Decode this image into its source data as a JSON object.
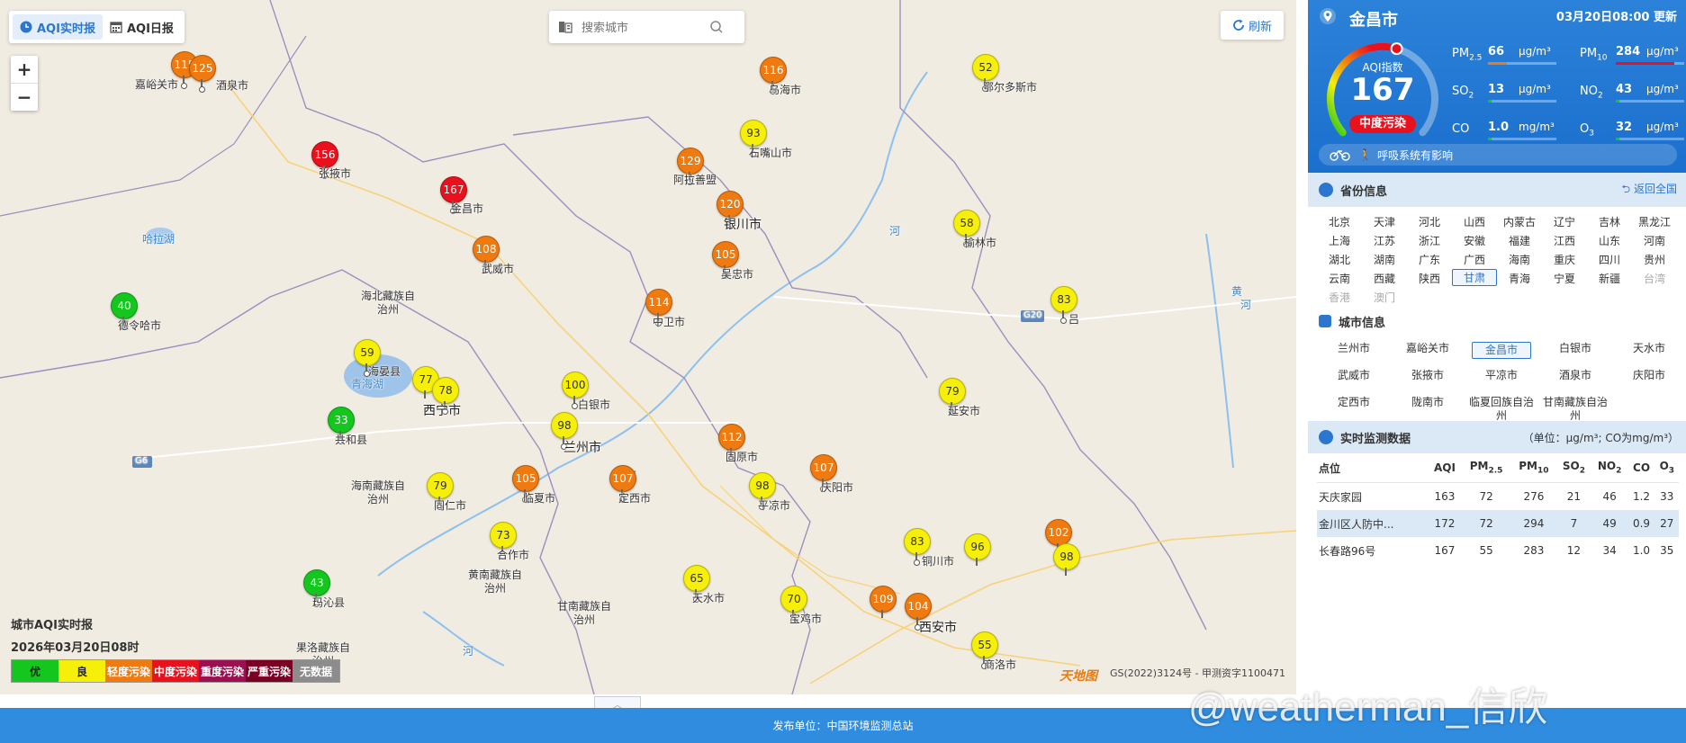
{
  "toolbar": {
    "tab_realtime": "AQI实时报",
    "tab_daily": "AQI日报",
    "search_placeholder": "搜索城市",
    "refresh_label": "刷新",
    "zoom_in": "+",
    "zoom_out": "−"
  },
  "map": {
    "legend_title": "城市AQI实时报",
    "legend_time": "2026年03月20日08时",
    "legend_items": [
      {
        "label": "优",
        "color": "#14c61e",
        "text_color": "#222222"
      },
      {
        "label": "良",
        "color": "#f5ef0a",
        "text_color": "#222222"
      },
      {
        "label": "轻度污染",
        "color": "#ef7a10",
        "text_color": "#ffffff"
      },
      {
        "label": "中度污染",
        "color": "#e8111d",
        "text_color": "#ffffff"
      },
      {
        "label": "重度污染",
        "color": "#9b1050",
        "text_color": "#ffffff"
      },
      {
        "label": "严重污染",
        "color": "#7a0024",
        "text_color": "#ffffff"
      },
      {
        "label": "无数据",
        "color": "#8c8c8c",
        "text_color": "#ffffff"
      }
    ],
    "copyright": "GS(2022)3124号 - 甲测资字1100471",
    "provider": "天地图",
    "regions": [
      "海北藏族自治州",
      "海南藏族自治州",
      "黄南藏族自治州",
      "甘南藏族自治州",
      "果洛藏族自治州"
    ],
    "water_labels": [
      "哈拉湖",
      "青海湖",
      "河",
      "河",
      "河",
      "黄",
      "河"
    ],
    "road_labels": [
      "G20",
      "G6"
    ],
    "markers": [
      {
        "value": "115",
        "level": "orange",
        "city": "嘉峪关市"
      },
      {
        "value": "125",
        "level": "orange",
        "city": "酒泉市"
      },
      {
        "value": "156",
        "level": "red",
        "city": "张掖市"
      },
      {
        "value": "167",
        "level": "red",
        "city": "金昌市"
      },
      {
        "value": "108",
        "level": "orange",
        "city": "武威市"
      },
      {
        "value": "40",
        "level": "green",
        "city": "德令哈市"
      },
      {
        "value": "59",
        "level": "yellow",
        "city": "海晏县"
      },
      {
        "value": "77",
        "level": "yellow",
        "city": ""
      },
      {
        "value": "78",
        "level": "yellow",
        "city": "西宁市"
      },
      {
        "value": "33",
        "level": "green",
        "city": "共和县"
      },
      {
        "value": "100",
        "level": "yellow",
        "city": "白银市"
      },
      {
        "value": "98",
        "level": "yellow",
        "city": "兰州市"
      },
      {
        "value": "105",
        "level": "orange",
        "city": "临夏市"
      },
      {
        "value": "107",
        "level": "orange",
        "city": "定西市"
      },
      {
        "value": "79",
        "level": "yellow",
        "city": "同仁市"
      },
      {
        "value": "73",
        "level": "yellow",
        "city": "合作市"
      },
      {
        "value": "43",
        "level": "green",
        "city": "玛沁县"
      },
      {
        "value": "65",
        "level": "yellow",
        "city": "天水市"
      },
      {
        "value": "70",
        "level": "yellow",
        "city": "宝鸡市"
      },
      {
        "value": "112",
        "level": "orange",
        "city": "固原市"
      },
      {
        "value": "98",
        "level": "yellow",
        "city": "平凉市"
      },
      {
        "value": "107",
        "level": "orange",
        "city": "庆阳市"
      },
      {
        "value": "114",
        "level": "orange",
        "city": "中卫市"
      },
      {
        "value": "105",
        "level": "orange",
        "city": "吴忠市"
      },
      {
        "value": "120",
        "level": "orange",
        "city": "银川市"
      },
      {
        "value": "129",
        "level": "orange",
        "city": "阿拉善盟"
      },
      {
        "value": "93",
        "level": "yellow",
        "city": "石嘴山市"
      },
      {
        "value": "116",
        "level": "orange",
        "city": "乌海市"
      },
      {
        "value": "52",
        "level": "yellow",
        "city": "鄂尔多斯市"
      },
      {
        "value": "58",
        "level": "yellow",
        "city": "榆林市"
      },
      {
        "value": "83",
        "level": "yellow",
        "city": "吕"
      },
      {
        "value": "79",
        "level": "yellow",
        "city": "延安市"
      },
      {
        "value": "83",
        "level": "yellow",
        "city": "铜川市"
      },
      {
        "value": "96",
        "level": "yellow",
        "city": ""
      },
      {
        "value": "102",
        "level": "orange",
        "city": ""
      },
      {
        "value": "98",
        "level": "yellow",
        "city": ""
      },
      {
        "value": "109",
        "level": "orange",
        "city": ""
      },
      {
        "value": "104",
        "level": "orange",
        "city": "西安市"
      },
      {
        "value": "55",
        "level": "yellow",
        "city": "商洛市"
      }
    ]
  },
  "panel": {
    "city": "金昌市",
    "update_time": "03月20日08:00 更新",
    "aqi_title": "AQI指数",
    "aqi_value": "167",
    "aqi_level": "中度污染",
    "aqi_fraction": 0.56,
    "pollutants": [
      {
        "name": "PM",
        "sub": "2.5",
        "value": "66",
        "unit": "μg/m³",
        "fill_fraction": 0.27,
        "color": "#ef7a10"
      },
      {
        "name": "PM",
        "sub": "10",
        "value": "284",
        "unit": "μg/m³",
        "fill_fraction": 0.85,
        "color": "#e8111d"
      },
      {
        "name": "SO",
        "sub": "2",
        "value": "13",
        "unit": "μg/m³",
        "fill_fraction": 0.05,
        "color": "#14c61e"
      },
      {
        "name": "NO",
        "sub": "2",
        "value": "43",
        "unit": "μg/m³",
        "fill_fraction": 0.05,
        "color": "#14c61e"
      },
      {
        "name": "CO",
        "sub": "",
        "value": "1.0",
        "unit": "mg/m³",
        "fill_fraction": 0.05,
        "color": "#14c61e"
      },
      {
        "name": "O",
        "sub": "3",
        "value": "32",
        "unit": "μg/m³",
        "fill_fraction": 0.05,
        "color": "#14c61e"
      }
    ],
    "health_tip": "呼吸系统有影响",
    "province_section": "省份信息",
    "return_all": "返回全国",
    "provinces": [
      "北京",
      "天津",
      "河北",
      "山西",
      "内蒙古",
      "辽宁",
      "吉林",
      "黑龙江",
      "上海",
      "江苏",
      "浙江",
      "安徽",
      "福建",
      "江西",
      "山东",
      "河南",
      "湖北",
      "湖南",
      "广东",
      "广西",
      "海南",
      "重庆",
      "四川",
      "贵州",
      "云南",
      "西藏",
      "陕西",
      "甘肃",
      "青海",
      "宁夏",
      "新疆",
      "台湾",
      "香港",
      "澳门"
    ],
    "selected_province": "甘肃",
    "dim_provinces": [
      "台湾",
      "香港",
      "澳门"
    ],
    "city_section": "城市信息",
    "cities": [
      "兰州市",
      "嘉峪关市",
      "金昌市",
      "白银市",
      "天水市",
      "武威市",
      "张掖市",
      "平凉市",
      "酒泉市",
      "庆阳市",
      "定西市",
      "陇南市",
      "临夏回族自治州",
      "甘南藏族自治州"
    ],
    "selected_city": "金昌市",
    "monitor_section": "实时监测数据",
    "monitor_unit": "（单位：μg/m³; CO为mg/m³）",
    "monitor_headers": [
      "点位",
      "AQI",
      "PM2.5",
      "PM10",
      "SO2",
      "NO2",
      "CO",
      "O3"
    ],
    "monitor_rows": [
      [
        "天庆家园",
        "163",
        "72",
        "276",
        "21",
        "46",
        "1.2",
        "33"
      ],
      [
        "金川区人防中...",
        "172",
        "72",
        "294",
        "7",
        "49",
        "0.9",
        "27"
      ],
      [
        "长春路96号",
        "167",
        "55",
        "283",
        "12",
        "34",
        "1.0",
        "35"
      ]
    ]
  },
  "footer": {
    "publisher": "发布单位：中国环境监测总站",
    "watermark": "@weatherman_信欣"
  }
}
